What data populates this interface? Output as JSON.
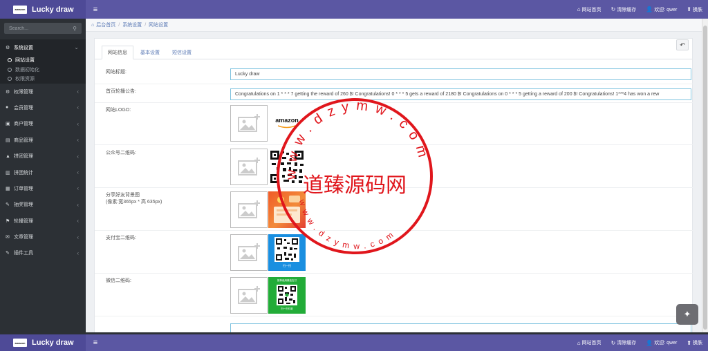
{
  "app": {
    "brand_logo_text": "amazon",
    "brand_name": "Lucky draw"
  },
  "topbar": {
    "links": [
      {
        "icon": "home-icon",
        "glyph": "⌂",
        "label": "网站首页"
      },
      {
        "icon": "refresh-icon",
        "glyph": "↻",
        "label": "清除缓存"
      },
      {
        "icon": "user-icon",
        "glyph": "👤",
        "label": "欢迎: qwer"
      },
      {
        "icon": "skin-icon",
        "glyph": "⬆",
        "label": "换肤"
      }
    ]
  },
  "sidebar": {
    "search_placeholder": "Search...",
    "open_group": {
      "label": "系统设置",
      "items": [
        {
          "label": "网站设置",
          "active": true
        },
        {
          "label": "数据初始化",
          "active": false
        },
        {
          "label": "权限资源",
          "active": false
        }
      ]
    },
    "items": [
      {
        "label": "权限管理",
        "icon": "gears-icon",
        "glyph": "⚙"
      },
      {
        "label": "会员管理",
        "icon": "user-icon",
        "glyph": "●"
      },
      {
        "label": "商户管理",
        "icon": "store-icon",
        "glyph": "▣"
      },
      {
        "label": "商品管理",
        "icon": "goods-icon",
        "glyph": "▤"
      },
      {
        "label": "拼团管理",
        "icon": "bell-icon",
        "glyph": "▲"
      },
      {
        "label": "拼团统计",
        "icon": "chart-icon",
        "glyph": "▥"
      },
      {
        "label": "订单管理",
        "icon": "order-icon",
        "glyph": "▦"
      },
      {
        "label": "抽奖管理",
        "icon": "wrench-icon",
        "glyph": "✎"
      },
      {
        "label": "轮播管理",
        "icon": "flag-icon",
        "glyph": "⚑"
      },
      {
        "label": "文章管理",
        "icon": "comment-icon",
        "glyph": "✉"
      },
      {
        "label": "插件工具",
        "icon": "plugin-icon",
        "glyph": "✎"
      }
    ]
  },
  "breadcrumb": {
    "items": [
      "后台首页",
      "系统设置",
      "网站设置"
    ]
  },
  "tabs": [
    {
      "label": "网站信息",
      "active": true
    },
    {
      "label": "基本设置",
      "active": false
    },
    {
      "label": "短信设置",
      "active": false
    }
  ],
  "form": {
    "site_title_label": "网站标题:",
    "site_title_value": "Lucky  draw",
    "carousel_label": "首页轮播公告:",
    "carousel_value": "Congratulations on 1 * * * 7 getting the reward of 260 $! Congratulations! 0 * * * 5 gets a reward of 2180 $! Congratulations on 0 * * * 5 getting a reward of 200 $! Congratulations! 1***4 has won a rew",
    "logo_label": "网站LOGO:",
    "logo_thumb_text": "amazon",
    "wechat_qr_label": "公众号二维码:",
    "share_bg_label": "分享好友背景图",
    "share_bg_hint": "(像素:宽365px * 高 635px)",
    "alipay_qr_label": "支付宝二维码:",
    "alipay_caption": "扫一扫",
    "weixin_qr_label": "微信二维码:",
    "weixin_top_text": "推荐使用微信支付",
    "weixin_caption": "扫一扫付款"
  },
  "watermark": {
    "center_text": "道臻源码网",
    "ring_text": "www.dzymw.com",
    "color": "#e0161c"
  },
  "colors": {
    "accent": "#5b57a3",
    "sidebar_bg": "#2c3035",
    "input_border": "#7fc3df"
  }
}
